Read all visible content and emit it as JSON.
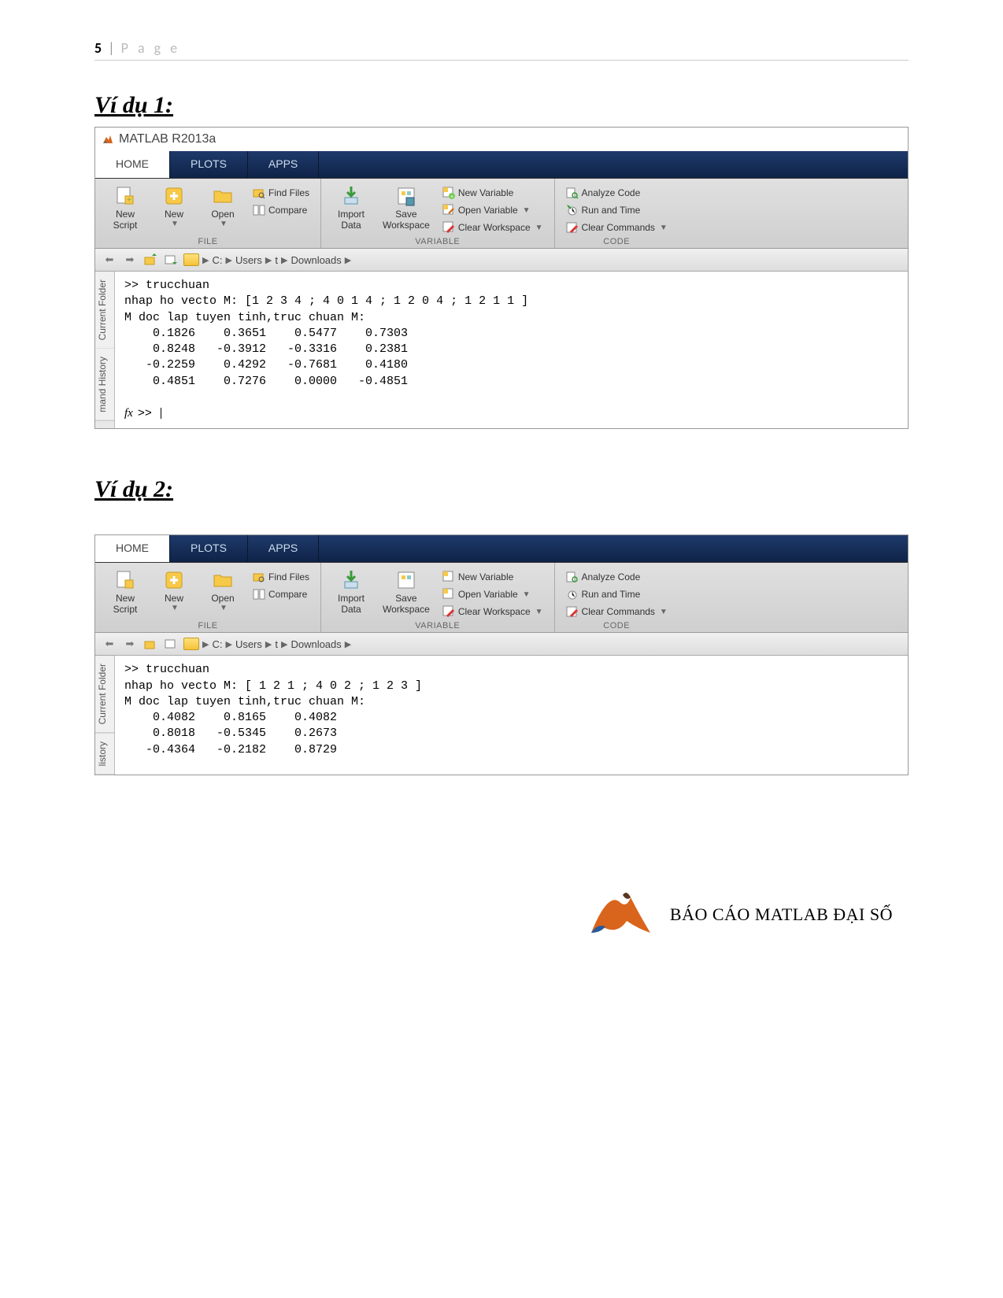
{
  "page_header": {
    "number": "5",
    "separator": "|",
    "label": "P a g e"
  },
  "heading1": "Ví dụ 1:",
  "heading2": "Ví dụ 2:",
  "app_title": "MATLAB R2013a",
  "tabs": {
    "home": "HOME",
    "plots": "PLOTS",
    "apps": "APPS"
  },
  "ribbon": {
    "file": {
      "newscript": "New\nScript",
      "new": "New",
      "open": "Open",
      "findfiles": "Find Files",
      "compare": "Compare",
      "label": "FILE"
    },
    "variable": {
      "import": "Import\nData",
      "save": "Save\nWorkspace",
      "newvar": "New Variable",
      "openvar": "Open Variable",
      "clearws": "Clear Workspace",
      "label": "VARIABLE"
    },
    "code": {
      "analyze": "Analyze Code",
      "run": "Run and Time",
      "clearcmd": "Clear Commands",
      "label": "CODE"
    }
  },
  "breadcrumb": [
    "C:",
    "Users",
    "t",
    "Downloads"
  ],
  "side": {
    "current": "Current Folder",
    "history": "mand History",
    "history2": "listory"
  },
  "console1": ">> trucchuan\nnhap ho vecto M: [1 2 3 4 ; 4 0 1 4 ; 1 2 0 4 ; 1 2 1 1 ]\nM doc lap tuyen tinh,truc chuan M:\n    0.1826    0.3651    0.5477    0.7303\n    0.8248   -0.3912   -0.3316    0.2381\n   -0.2259    0.4292   -0.7681    0.4180\n    0.4851    0.7276    0.0000   -0.4851\n",
  "console2": ">> trucchuan\nnhap ho vecto M: [ 1 2 1 ; 4 0 2 ; 1 2 3 ]\nM doc lap tuyen tinh,truc chuan M:\n    0.4082    0.8165    0.4082\n    0.8018   -0.5345    0.2673\n   -0.4364   -0.2182    0.8729",
  "footer_text": "BÁO CÁO MATLAB ĐẠI SỐ"
}
